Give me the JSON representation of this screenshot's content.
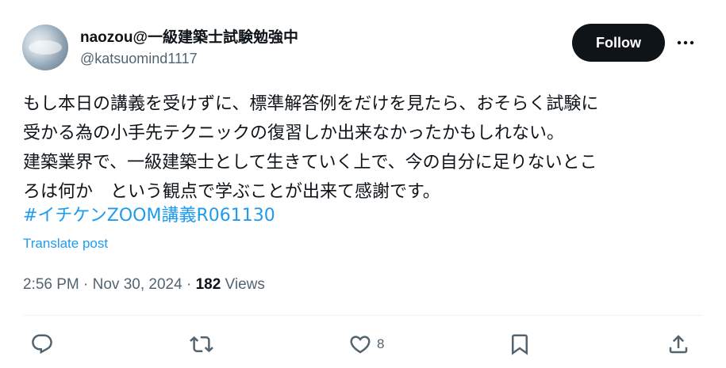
{
  "author": {
    "display_name": "naozou@一級建築士試験勉強中",
    "handle": "@katsuomind1117"
  },
  "follow_button": {
    "label": "Follow"
  },
  "post": {
    "text": "もし本日の講義を受けずに、標準解答例をだけを見たら、おそらく試験に\n受かる為の小手先テクニックの復習しか出来なかったかもしれない。\n建築業界で、一級建築士として生きていく上で、今の自分に足りないとこ\nろは何か　という観点で学ぶことが出来て感謝です。",
    "hashtag": "#イチケンZOOM講義R061130",
    "translate_label": "Translate post",
    "timestamp": "2:56 PM · Nov 30, 2024 · ",
    "views_count": "182",
    "views_label": " Views"
  },
  "actions": {
    "reply_icon": "reply-icon",
    "repost_icon": "repost-icon",
    "like_icon": "like-icon",
    "like_count": "8",
    "bookmark_icon": "bookmark-icon",
    "share_icon": "share-icon"
  },
  "colors": {
    "link": "#1d9bf0",
    "secondary_text": "#536471",
    "primary_text": "#0f1419",
    "follow_bg": "#0f1419"
  }
}
